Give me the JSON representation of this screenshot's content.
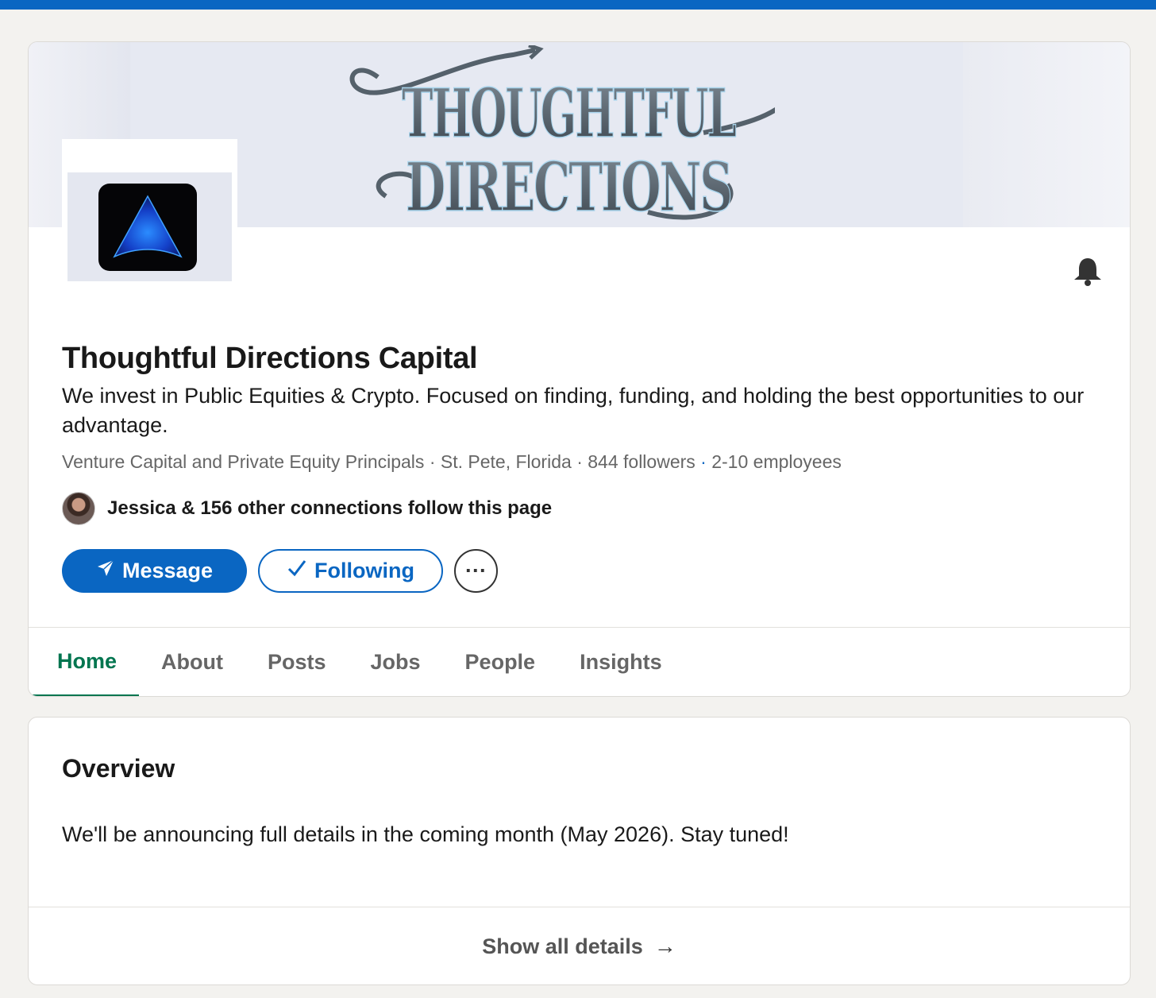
{
  "company": {
    "name": "Thoughtful Directions Capital",
    "tagline": "We invest in Public Equities & Crypto. Focused on finding, funding, and holding the best opportunities to our advantage.",
    "industry": "Venture Capital and Private Equity Principals",
    "location": "St. Pete, Florida",
    "followers": "844 followers",
    "employees": "2-10 employees"
  },
  "banner": {
    "line1": "THOUGHTFUL",
    "line2": "DIRECTIONS"
  },
  "connections": {
    "text": "Jessica & 156 other connections follow this page"
  },
  "actions": {
    "message_label": "Message",
    "following_label": "Following",
    "more_label": "···"
  },
  "tabs": [
    {
      "label": "Home",
      "active": true
    },
    {
      "label": "About"
    },
    {
      "label": "Posts"
    },
    {
      "label": "Jobs"
    },
    {
      "label": "People"
    },
    {
      "label": "Insights"
    }
  ],
  "overview": {
    "title": "Overview",
    "body": "We'll be announcing full details in the coming month (May 2026). Stay tuned!",
    "show_all_label": "Show all details",
    "show_all_arrow": "→"
  },
  "icons": {
    "send": "send-icon",
    "check": "checkmark-icon",
    "bell": "bell-icon",
    "more": "ellipsis-icon",
    "arrow": "arrow-right-icon"
  },
  "colors": {
    "primary": "#0a66c2",
    "active_tab": "#01754f",
    "background": "#f3f2ef"
  }
}
